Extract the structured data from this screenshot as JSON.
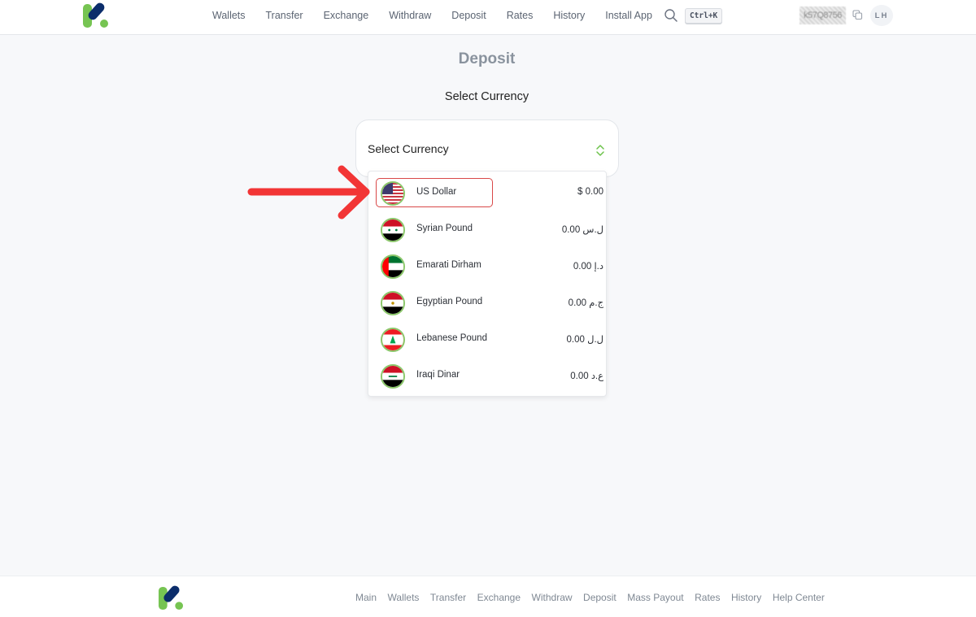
{
  "header": {
    "logo": "k-logo",
    "nav": [
      "Wallets",
      "Transfer",
      "Exchange",
      "Withdraw",
      "Deposit",
      "Rates",
      "History",
      "Install App"
    ],
    "search_icon": "search-icon",
    "shortcut": "Ctrl+K",
    "user_id": "k57Q8756",
    "copy_icon": "copy-icon",
    "avatar_initials": "LH"
  },
  "main": {
    "title": "Deposit",
    "section_label": "Select Currency",
    "select": {
      "placeholder": "Select Currency",
      "icon": "chevron-up-down-icon"
    },
    "options": [
      {
        "name": "US Dollar",
        "balance": "$ 0.00",
        "flag": "us-flag-icon",
        "selected": true
      },
      {
        "name": "Syrian Pound",
        "balance": "0.00 ل.س",
        "flag": "syria-flag-icon",
        "selected": false
      },
      {
        "name": "Emarati Dirham",
        "balance": "0.00 د.إ",
        "flag": "uae-flag-icon",
        "selected": false
      },
      {
        "name": "Egyptian Pound",
        "balance": "0.00 ج.م",
        "flag": "egypt-flag-icon",
        "selected": false
      },
      {
        "name": "Lebanese Pound",
        "balance": "0.00 ل.ل",
        "flag": "lebanon-flag-icon",
        "selected": false
      },
      {
        "name": "Iraqi Dinar",
        "balance": "0.00 ع.د",
        "flag": "iraq-flag-icon",
        "selected": false
      }
    ]
  },
  "annotation": {
    "icon": "red-arrow-icon",
    "color": "#f23535"
  },
  "footer": {
    "logo": "k-logo",
    "nav": [
      "Main",
      "Wallets",
      "Transfer",
      "Exchange",
      "Withdraw",
      "Deposit",
      "Mass Payout",
      "Rates",
      "History",
      "Help Center"
    ]
  },
  "colors": {
    "brand_green": "#76c452",
    "brand_navy": "#0b2d6b",
    "selected_border": "#d94848",
    "flag_ring": "#8bc76a"
  }
}
